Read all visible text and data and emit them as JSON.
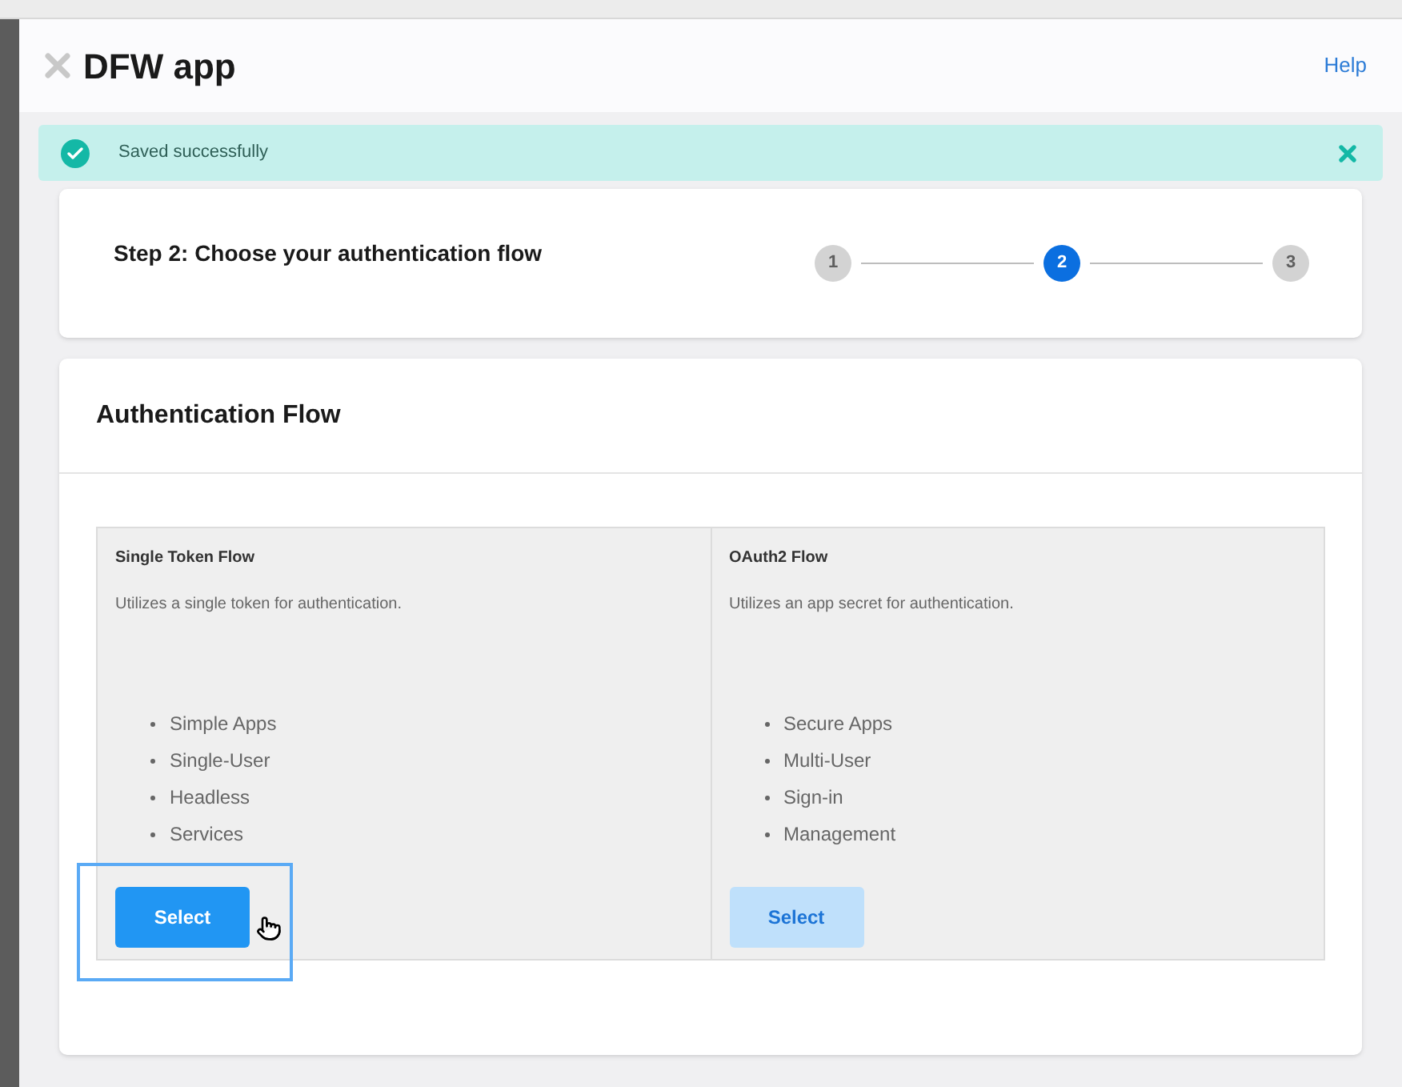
{
  "modal": {
    "title": "DFW app",
    "help_link": "Help"
  },
  "toast": {
    "message": "Saved successfully",
    "kind": "success"
  },
  "step": {
    "title": "Step 2: Choose your authentication flow",
    "steps": [
      {
        "label": "1",
        "selected": false
      },
      {
        "label": "2",
        "selected": true
      },
      {
        "label": "3",
        "selected": false
      }
    ]
  },
  "panel": {
    "title": "Authentication Flow",
    "options": [
      {
        "title": "Single Token Flow",
        "description": "Utilizes a single token for authentication.",
        "features": [
          "Simple Apps",
          "Single-User",
          "Headless",
          "Services"
        ],
        "button": "Select",
        "selected": true
      },
      {
        "title": "OAuth2 Flow",
        "description": "Utilizes an app secret for authentication.",
        "features": [
          "Secure Apps",
          "Multi-User",
          "Sign-in",
          "Management"
        ],
        "button": "Select",
        "selected": false
      }
    ]
  }
}
